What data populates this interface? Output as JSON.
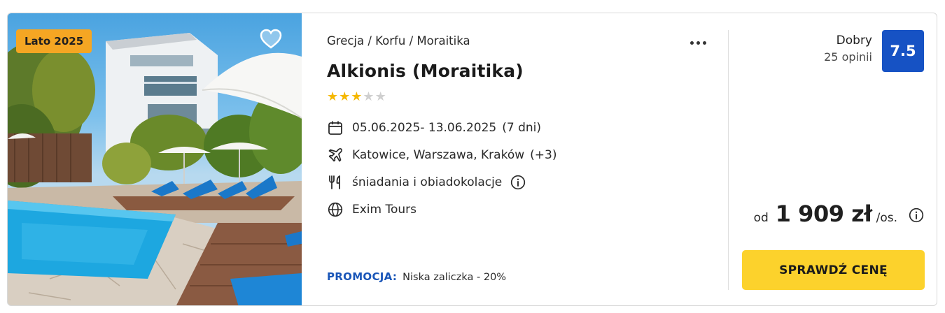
{
  "offer": {
    "season_badge": "Lato 2025",
    "breadcrumb": "Grecja / Korfu / Moraitika",
    "hotel_name": "Alkionis (Moraitika)",
    "stars": {
      "filled": 3,
      "total": 5
    },
    "dates": "05.06.2025- 13.06.2025",
    "duration": "(7 dni)",
    "departures": "Katowice, Warszawa, Kraków",
    "departures_extra": "(+3)",
    "board": "śniadania i obiadokolacje",
    "operator": "Exim Tours",
    "promo_label": "PROMOCJA:",
    "promo_text": "Niska zaliczka - 20%"
  },
  "rating": {
    "label": "Dobry",
    "reviews": "25 opinii",
    "score": "7.5"
  },
  "price": {
    "prefix": "od",
    "amount": "1 909 zł",
    "suffix": "/os."
  },
  "cta": {
    "label": "SPRAWDŹ CENĘ"
  },
  "icons": {
    "favorite": "heart-icon",
    "more": "more-horizontal-icon",
    "dates": "calendar-icon",
    "departures": "plane-icon",
    "board": "cutlery-icon",
    "operator": "globe-icon",
    "info": "info-icon"
  },
  "colors": {
    "accent_blue": "#1652c4",
    "badge_orange": "#f5a623",
    "cta_yellow": "#fcd22c",
    "star_gold": "#f5b800"
  }
}
